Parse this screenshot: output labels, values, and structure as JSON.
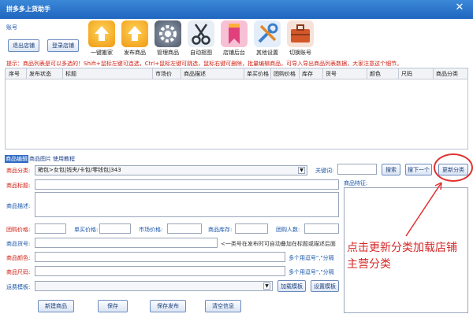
{
  "window": {
    "title": "拼多多上货助手",
    "close_icon": "close-icon"
  },
  "account": {
    "label": "账号"
  },
  "buttons": {
    "logout_store": "退出店铺",
    "login_store": "登录店铺"
  },
  "toolbar": [
    {
      "label": "一键搬家",
      "icon": "upload-icon",
      "color": "#f0a020"
    },
    {
      "label": "发布商品",
      "icon": "upload-icon",
      "color": "#f0a020"
    },
    {
      "label": "管理商品",
      "icon": "gear-icon",
      "color": "#5f6b7c"
    },
    {
      "label": "自动抠图",
      "icon": "scissors-icon",
      "color": "#3a3f48"
    },
    {
      "label": "店铺后台",
      "icon": "bookmark-icon",
      "color": "#e35c93"
    },
    {
      "label": "其他设置",
      "icon": "wrench-icon",
      "color": "#4a92d6"
    },
    {
      "label": "切换账号",
      "icon": "briefcase-icon",
      "color": "#d4572a"
    }
  ],
  "hint": "提示：商品列表是可以多选的！Shift+鼠标左键可连选，Ctrl+鼠标左键可跳选，鼠标右键可删除，批量编辑商品，可导入导出商品列表数据，大家注意这个细节。",
  "table": {
    "columns": [
      "序号",
      "发布状态",
      "标题",
      "市场价",
      "商品描述",
      "单买价格",
      "团购价格",
      "库存",
      "货号",
      "颜色",
      "尺码",
      "商品分类"
    ]
  },
  "tabs": [
    "商品编辑",
    "商品图片",
    "使用教程"
  ],
  "form": {
    "category_label": "商品分类:",
    "category_value": "箱包>女包|钱夹/卡包/零钱包|343",
    "keyword_label": "关键词:",
    "keyword_value": "",
    "search_button": "搜索",
    "next_button": "搜下一个",
    "update_category_button": "更新分类",
    "title_label": "商品标题:",
    "title_value": "",
    "desc_label": "商品描述:",
    "desc_value": "",
    "feature_label": "商品特征:",
    "group_price_label": "团购价格:",
    "single_price_label": "单买价格:",
    "market_price_label": "市场价格:",
    "stock_label": "商品库存:",
    "group_size_label": "团购人数:",
    "sku_label": "商品货号:",
    "sku_note": "<一类号在发布时可自动叠加在标题或描述后面",
    "color_label": "商品颜色:",
    "color_note": "多个用逗号\",\"分隔",
    "size_label": "商品尺码:",
    "size_note": "多个用逗号\",\"分隔",
    "shipping_label": "运费模板:",
    "load_template_button": "加载模板",
    "set_template_button": "设置模板"
  },
  "bottom_buttons": [
    "新建商品",
    "保存",
    "保存发布",
    "清空信息"
  ],
  "annotation": "点击更新分类加载店铺主营分类"
}
